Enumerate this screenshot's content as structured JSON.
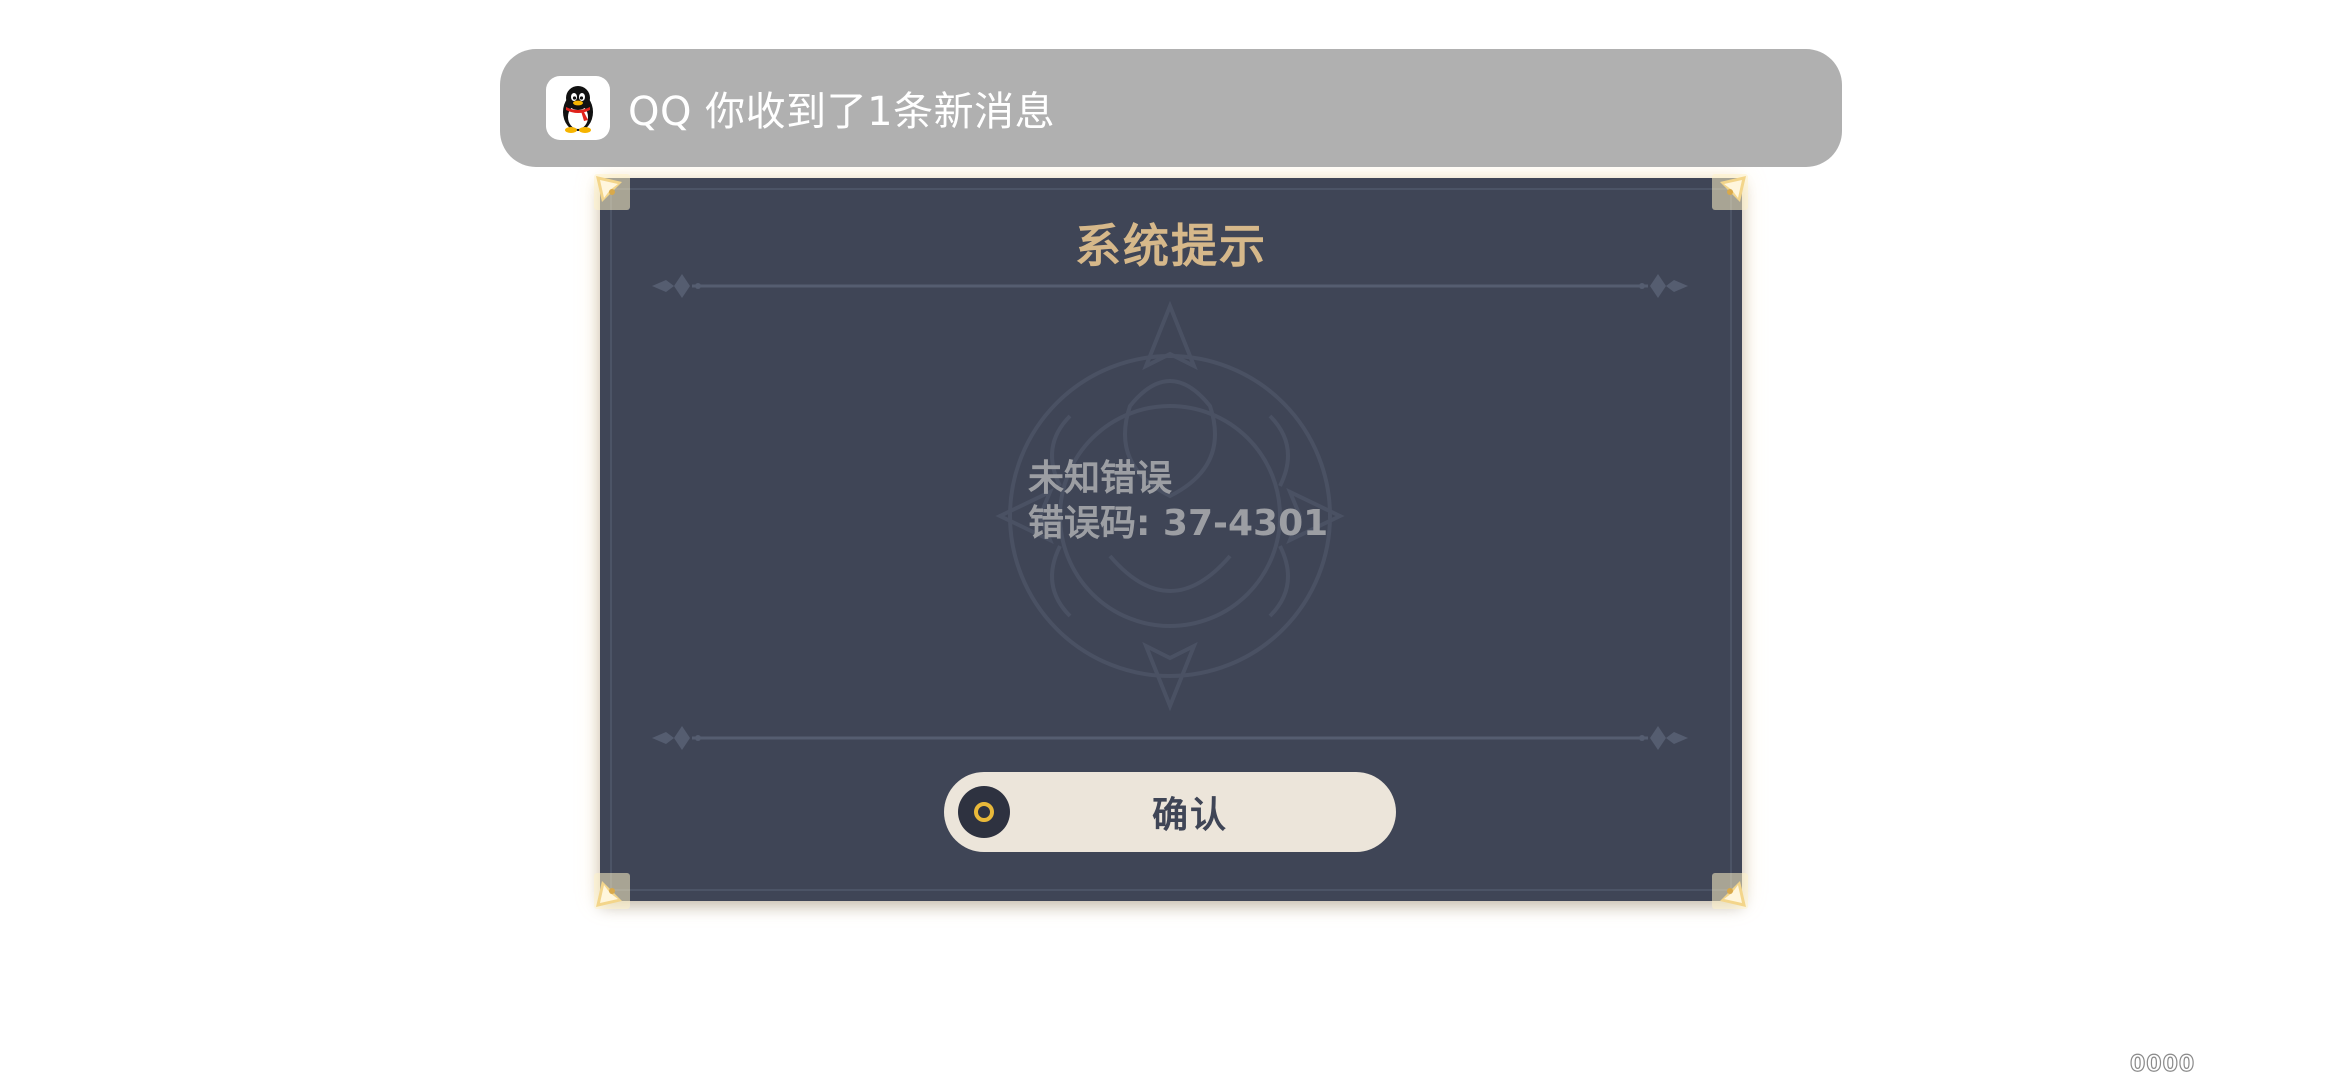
{
  "notification": {
    "app_icon": "qq-penguin-icon",
    "text": "QQ 你收到了1条新消息"
  },
  "dialog": {
    "title": "系统提示",
    "message_line1": "未知错误",
    "message_line2": "错误码: 37-4301",
    "confirm_icon": "circle-button-icon",
    "confirm_label": "确认"
  },
  "corner_code": "0000",
  "colors": {
    "dialog_bg": "#3f4556",
    "title": "#d6b88a",
    "button_bg": "#ece5da",
    "notification_bg": "#b0b0b0",
    "accent_gold": "#e9b93a"
  }
}
